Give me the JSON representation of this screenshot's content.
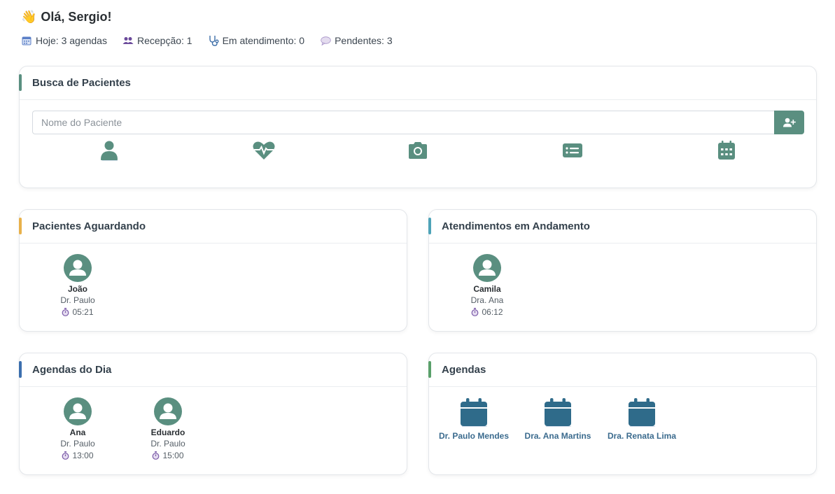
{
  "greeting": {
    "emoji": "👋",
    "text": "Olá, Sergio!"
  },
  "stats": [
    {
      "icon": "calendar-icon",
      "label": "Hoje: 3 agendas"
    },
    {
      "icon": "users-icon",
      "label": "Recepção: 1"
    },
    {
      "icon": "stethoscope-icon",
      "label": "Em atendimento: 0"
    },
    {
      "icon": "speech-bubble-icon",
      "label": "Pendentes: 3"
    }
  ],
  "search_card": {
    "title": "Busca de Pacientes",
    "placeholder": "Nome do Paciente",
    "accent": "#5a8f80"
  },
  "waiting_card": {
    "title": "Pacientes Aguardando",
    "accent": "#e8b14a",
    "patients": [
      {
        "name": "João",
        "doctor": "Dr. Paulo",
        "time": "05:21"
      }
    ]
  },
  "ongoing_card": {
    "title": "Atendimentos em Andamento",
    "accent": "#4ea3b8",
    "patients": [
      {
        "name": "Camila",
        "doctor": "Dra. Ana",
        "time": "06:12"
      }
    ]
  },
  "today_card": {
    "title": "Agendas do Dia",
    "accent": "#3c6fae",
    "patients": [
      {
        "name": "Ana",
        "doctor": "Dr. Paulo",
        "time": "13:00"
      },
      {
        "name": "Eduardo",
        "doctor": "Dr. Paulo",
        "time": "15:00"
      }
    ]
  },
  "agendas_card": {
    "title": "Agendas",
    "accent": "#5aa06a",
    "doctors": [
      {
        "name": "Dr. Paulo Mendes"
      },
      {
        "name": "Dra. Ana Martins"
      },
      {
        "name": "Dra. Renata Lima"
      }
    ]
  },
  "colors": {
    "primary": "#5a8f80",
    "calendar": "#2f6b8a"
  }
}
